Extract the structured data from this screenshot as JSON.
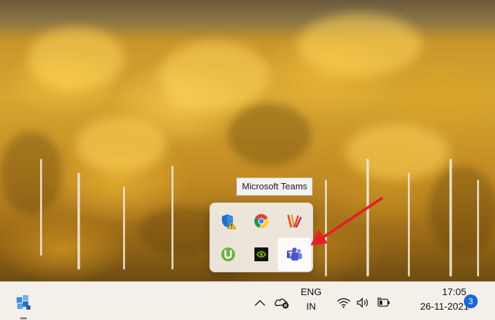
{
  "tooltip": {
    "text": "Microsoft Teams"
  },
  "overflow_icons": [
    {
      "name": "windows-security-warning-icon",
      "row": 0,
      "col": 0
    },
    {
      "name": "chrome-icon",
      "row": 0,
      "col": 1
    },
    {
      "name": "winamp-icon",
      "row": 0,
      "col": 2
    },
    {
      "name": "utorrent-icon",
      "row": 1,
      "col": 0
    },
    {
      "name": "nvidia-icon",
      "row": 1,
      "col": 1
    },
    {
      "name": "microsoft-teams-icon",
      "row": 1,
      "col": 2,
      "hovered": true
    }
  ],
  "taskbar": {
    "language": {
      "line1": "ENG",
      "line2": "IN"
    },
    "clock": {
      "time": "17:05",
      "date": "26-11-2021"
    },
    "notification_count": "3"
  },
  "colors": {
    "annotation_arrow": "#e32227",
    "taskbar_bg": "#f3efe9",
    "badge_bg": "#1967d2"
  }
}
